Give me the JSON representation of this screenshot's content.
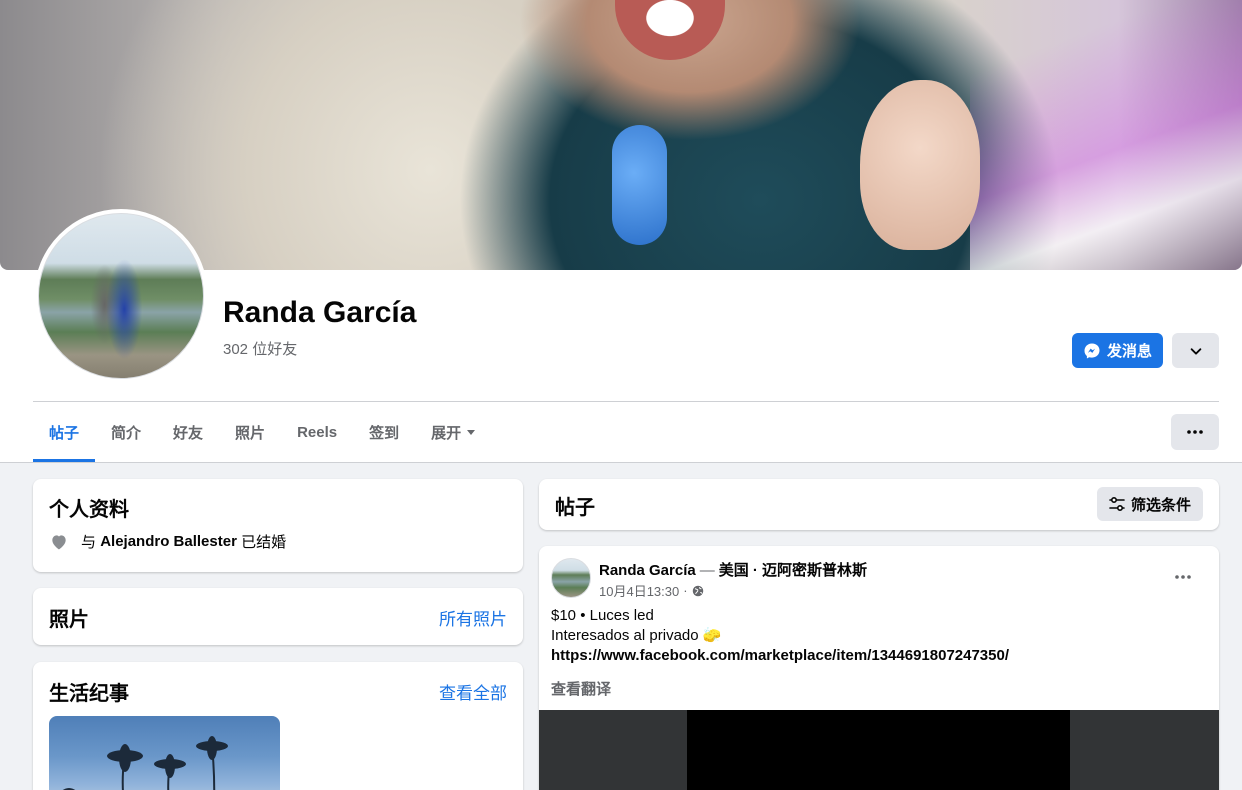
{
  "profile": {
    "name": "Randa García",
    "friends": "302 位好友",
    "message_label": "发消息"
  },
  "tabs": [
    "帖子",
    "简介",
    "好友",
    "照片",
    "Reels",
    "签到",
    "展开"
  ],
  "intro": {
    "title": "个人资料",
    "relation_prefix": "与",
    "relation_person": "Alejandro Ballester",
    "relation_suffix": "已结婚"
  },
  "photos": {
    "title": "照片",
    "link": "所有照片"
  },
  "life_events": {
    "title": "生活纪事",
    "link": "查看全部"
  },
  "posts": {
    "title": "帖子",
    "filter_label": "筛选条件"
  },
  "post": {
    "author": "Randa García",
    "dash": "—",
    "location": "美国 · 迈阿密斯普林斯",
    "time": "10月4日13:30",
    "dot": "·",
    "line1": "$10 • Luces led",
    "line2": "Interesados al privado 🧽",
    "link": "https://www.facebook.com/marketplace/item/1344691807247350/",
    "translate": "查看翻译"
  },
  "colors": {
    "accent": "#1b74e4",
    "secondary_text": "#65676b",
    "bg": "#f0f2f5"
  },
  "icons": [
    "messenger-icon",
    "chevron-down-icon",
    "more-icon",
    "heart-icon",
    "filter-icon",
    "globe-icon"
  ]
}
